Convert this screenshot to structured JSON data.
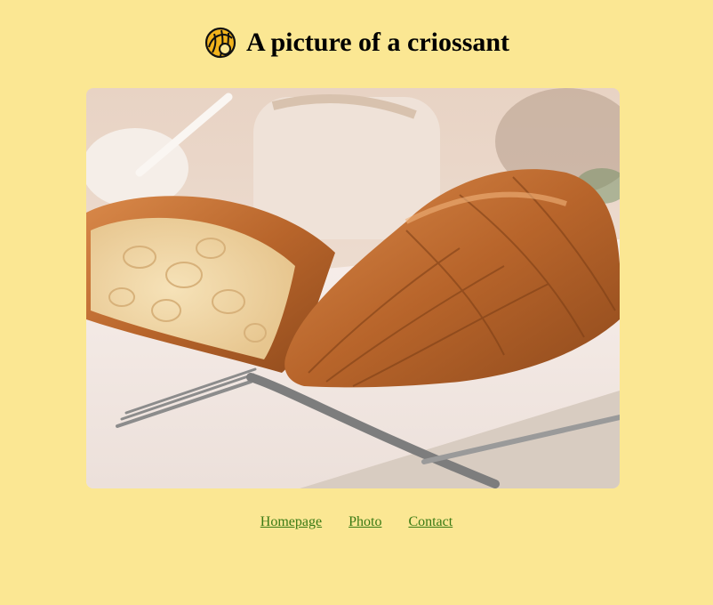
{
  "header": {
    "title": "A picture of a criossant",
    "logo_icon": "croissant-icon"
  },
  "photo": {
    "subject": "croissant-photo"
  },
  "nav": {
    "items": [
      {
        "label": "Homepage"
      },
      {
        "label": "Photo"
      },
      {
        "label": "Contact"
      }
    ]
  },
  "colors": {
    "background": "#fbe793",
    "link": "#3a7a14",
    "logo_fill": "#f2b31c"
  }
}
